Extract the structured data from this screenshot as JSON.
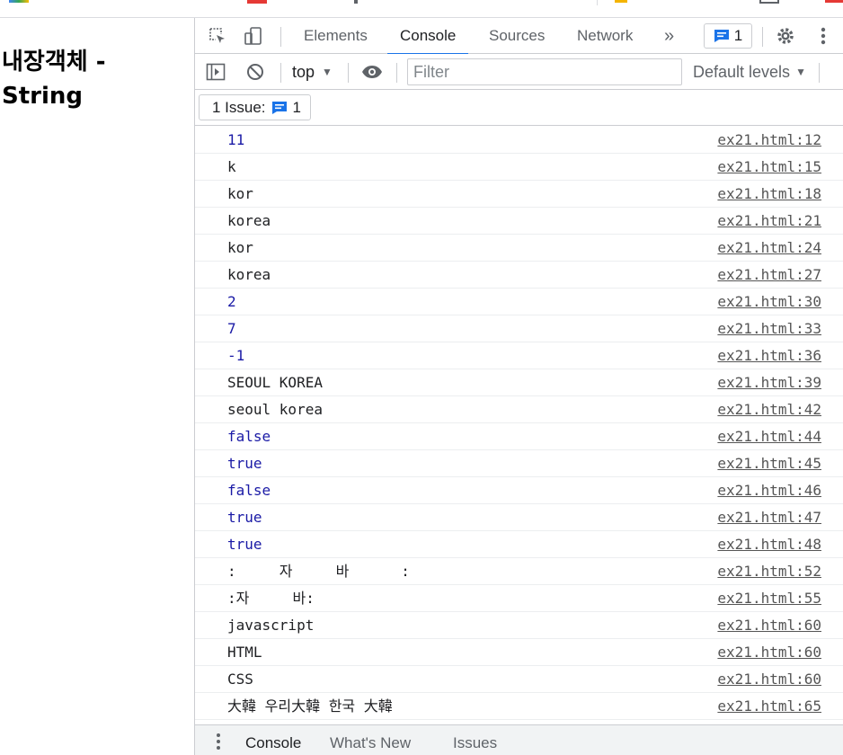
{
  "page": {
    "heading": "내장객체 - String"
  },
  "devtools": {
    "tabs": [
      "Elements",
      "Console",
      "Sources",
      "Network"
    ],
    "active_tab": "Console",
    "more_tabs_glyph": "»",
    "message_badge_count": "1",
    "toolbar": {
      "context": "top",
      "filter_placeholder": "Filter",
      "levels": "Default levels"
    },
    "issues": {
      "label": "1 Issue:",
      "count": "1"
    },
    "console_rows": [
      {
        "msg": "11",
        "type": "number",
        "src": "ex21.html:12"
      },
      {
        "msg": "k",
        "type": "string",
        "src": "ex21.html:15"
      },
      {
        "msg": "kor",
        "type": "string",
        "src": "ex21.html:18"
      },
      {
        "msg": "korea",
        "type": "string",
        "src": "ex21.html:21"
      },
      {
        "msg": "kor",
        "type": "string",
        "src": "ex21.html:24"
      },
      {
        "msg": "korea",
        "type": "string",
        "src": "ex21.html:27"
      },
      {
        "msg": "2",
        "type": "number",
        "src": "ex21.html:30"
      },
      {
        "msg": "7",
        "type": "number",
        "src": "ex21.html:33"
      },
      {
        "msg": "-1",
        "type": "number",
        "src": "ex21.html:36"
      },
      {
        "msg": "SEOUL KOREA",
        "type": "string",
        "src": "ex21.html:39"
      },
      {
        "msg": "seoul korea",
        "type": "string",
        "src": "ex21.html:42"
      },
      {
        "msg": "false",
        "type": "number",
        "src": "ex21.html:44"
      },
      {
        "msg": "true",
        "type": "number",
        "src": "ex21.html:45"
      },
      {
        "msg": "false",
        "type": "number",
        "src": "ex21.html:46"
      },
      {
        "msg": "true",
        "type": "number",
        "src": "ex21.html:47"
      },
      {
        "msg": "true",
        "type": "number",
        "src": "ex21.html:48"
      },
      {
        "msg": ":     자     바      :",
        "type": "string",
        "src": "ex21.html:52"
      },
      {
        "msg": ":자     바:",
        "type": "string",
        "src": "ex21.html:55"
      },
      {
        "msg": "javascript",
        "type": "string",
        "src": "ex21.html:60"
      },
      {
        "msg": "HTML",
        "type": "string",
        "src": "ex21.html:60"
      },
      {
        "msg": "CSS",
        "type": "string",
        "src": "ex21.html:60"
      },
      {
        "msg": "大韓 우리大韓 한국 大韓",
        "type": "string",
        "src": "ex21.html:65"
      }
    ],
    "drawer_tabs": [
      "Console",
      "What's New",
      "Issues"
    ],
    "colors": {
      "accent": "#1a73e8",
      "number_text": "#1a1aa6",
      "link_text": "#555555"
    }
  }
}
